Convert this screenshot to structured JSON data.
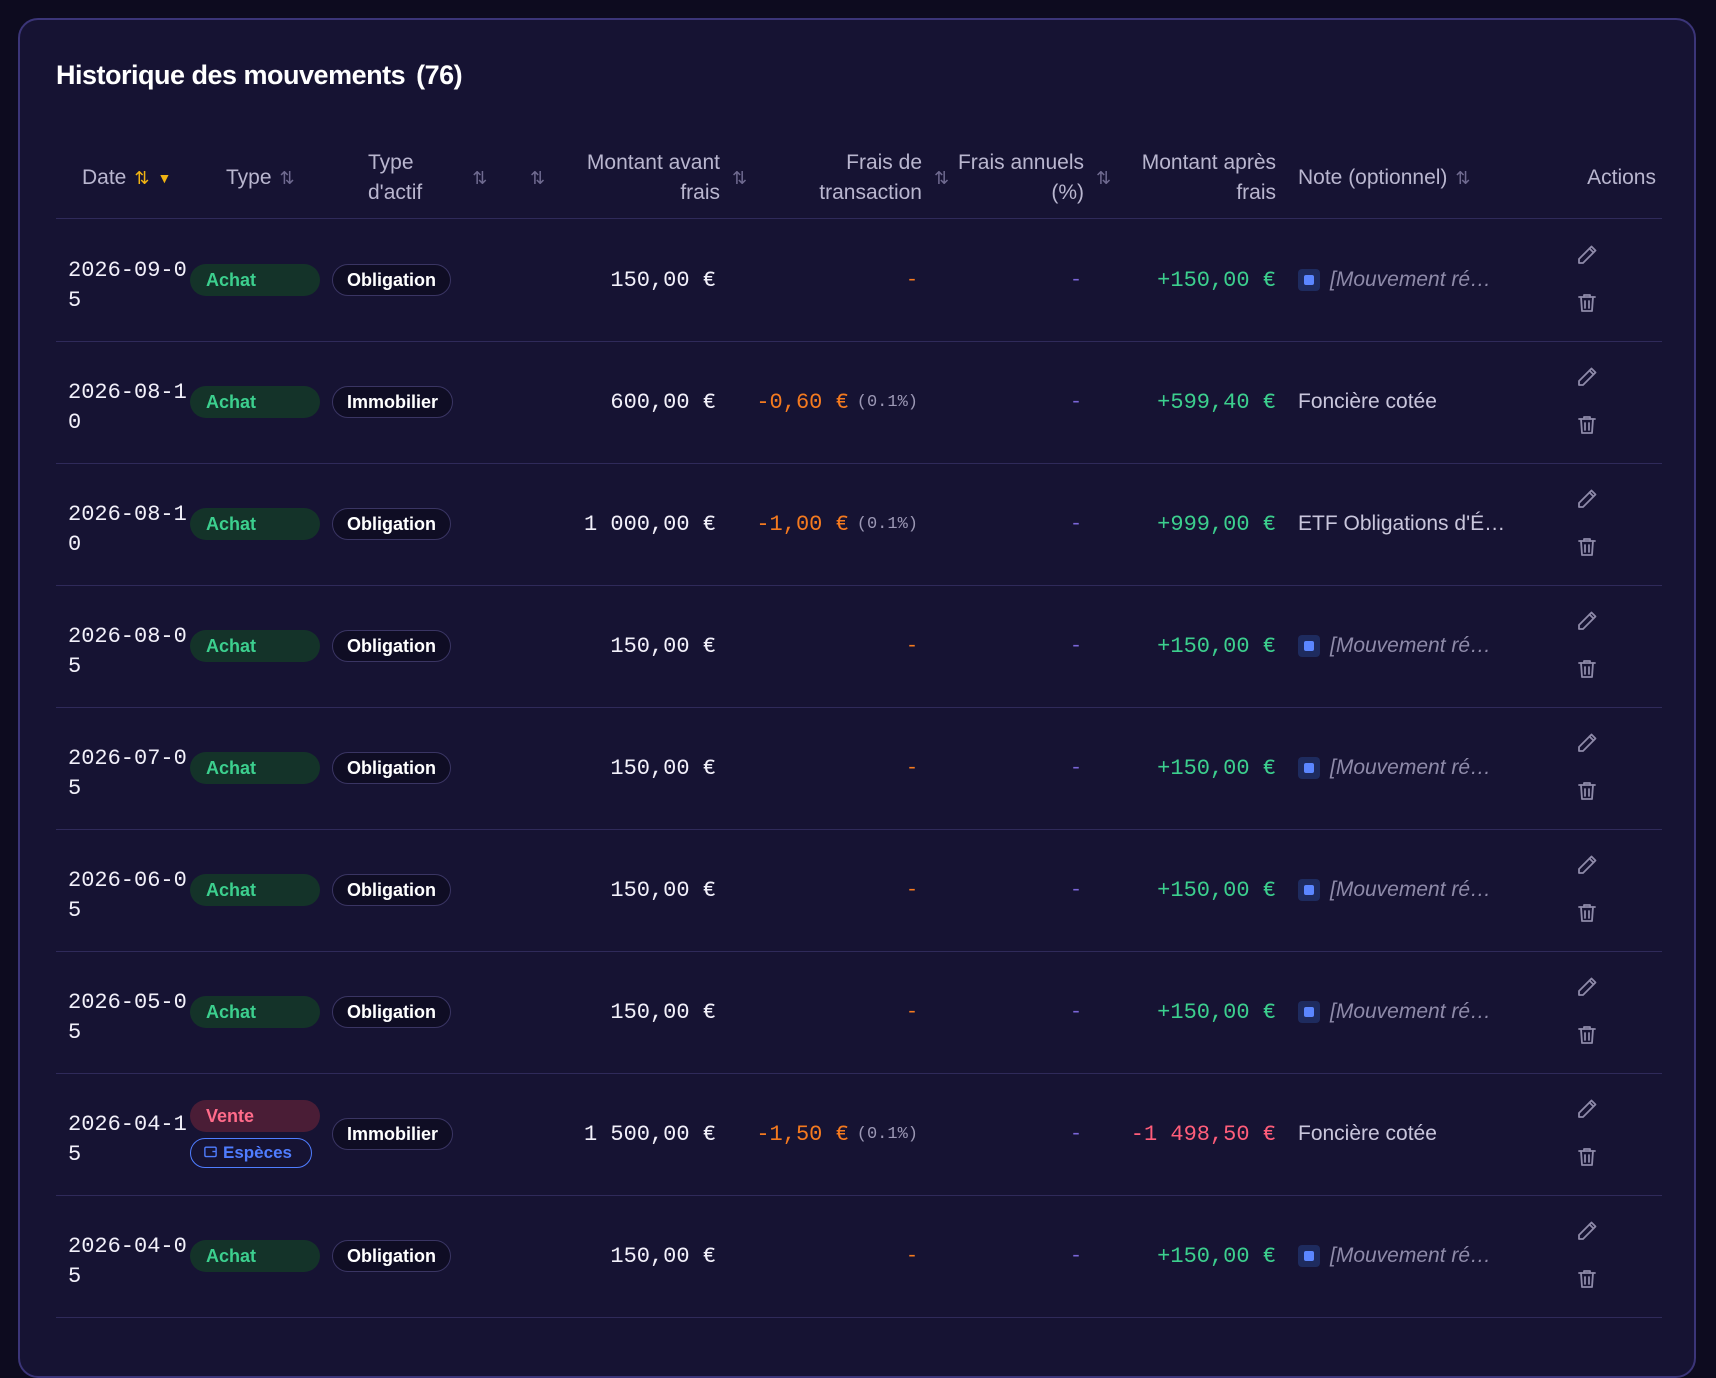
{
  "title": "Historique des mouvements",
  "count": "(76)",
  "columns": {
    "date": "Date",
    "type": "Type",
    "asset_type_line1": "Type",
    "asset_type_line2": "d'actif",
    "amount_before_line1": "Montant avant",
    "amount_before_line2": "frais",
    "tx_fees_line1": "Frais de",
    "tx_fees_line2": "transaction",
    "annual_fees_line1": "Frais annuels",
    "annual_fees_line2": "(%)",
    "amount_after_line1": "Montant après",
    "amount_after_line2": "frais",
    "note": "Note (optionnel)",
    "actions": "Actions"
  },
  "icons": {
    "sort": "sort-arrows-icon",
    "edit": "pencil-icon",
    "delete": "trash-icon",
    "auto": "auto-movement-icon",
    "wallet": "wallet-icon"
  },
  "colors": {
    "buy": "#3ccf8e",
    "sell": "#ff6b8a",
    "fee": "#f47a1f",
    "accent": "#f0b313",
    "cash": "#4f7dff"
  },
  "rows": [
    {
      "date": "2026-09-05",
      "type": "Achat",
      "asset": "Obligation",
      "amount": "150,00 €",
      "fee": "-",
      "fee_pct": "",
      "annual": "-",
      "after": "+150,00 €",
      "after_sign": "pos",
      "note": "[Mouvement ré…",
      "note_auto": true
    },
    {
      "date": "2026-08-10",
      "type": "Achat",
      "asset": "Immobilier",
      "amount": "600,00 €",
      "fee": "-0,60 €",
      "fee_pct": "(0.1%)",
      "annual": "-",
      "after": "+599,40 €",
      "after_sign": "pos",
      "note": "Foncière cotée",
      "note_auto": false
    },
    {
      "date": "2026-08-10",
      "type": "Achat",
      "asset": "Obligation",
      "amount": "1 000,00 €",
      "fee": "-1,00 €",
      "fee_pct": "(0.1%)",
      "annual": "-",
      "after": "+999,00 €",
      "after_sign": "pos",
      "note": "ETF Obligations d'É…",
      "note_auto": false
    },
    {
      "date": "2026-08-05",
      "type": "Achat",
      "asset": "Obligation",
      "amount": "150,00 €",
      "fee": "-",
      "fee_pct": "",
      "annual": "-",
      "after": "+150,00 €",
      "after_sign": "pos",
      "note": "[Mouvement ré…",
      "note_auto": true
    },
    {
      "date": "2026-07-05",
      "type": "Achat",
      "asset": "Obligation",
      "amount": "150,00 €",
      "fee": "-",
      "fee_pct": "",
      "annual": "-",
      "after": "+150,00 €",
      "after_sign": "pos",
      "note": "[Mouvement ré…",
      "note_auto": true
    },
    {
      "date": "2026-06-05",
      "type": "Achat",
      "asset": "Obligation",
      "amount": "150,00 €",
      "fee": "-",
      "fee_pct": "",
      "annual": "-",
      "after": "+150,00 €",
      "after_sign": "pos",
      "note": "[Mouvement ré…",
      "note_auto": true
    },
    {
      "date": "2026-05-05",
      "type": "Achat",
      "asset": "Obligation",
      "amount": "150,00 €",
      "fee": "-",
      "fee_pct": "",
      "annual": "-",
      "after": "+150,00 €",
      "after_sign": "pos",
      "note": "[Mouvement ré…",
      "note_auto": true
    },
    {
      "date": "2026-04-15",
      "type": "Vente",
      "cash_badge": "Espèces",
      "asset": "Immobilier",
      "amount": "1 500,00 €",
      "fee": "-1,50 €",
      "fee_pct": "(0.1%)",
      "annual": "-",
      "after": "-1 498,50 €",
      "after_sign": "neg",
      "note": "Foncière cotée",
      "note_auto": false
    },
    {
      "date": "2026-04-05",
      "type": "Achat",
      "asset": "Obligation",
      "amount": "150,00 €",
      "fee": "-",
      "fee_pct": "",
      "annual": "-",
      "after": "+150,00 €",
      "after_sign": "pos",
      "note": "[Mouvement ré…",
      "note_auto": true
    }
  ]
}
